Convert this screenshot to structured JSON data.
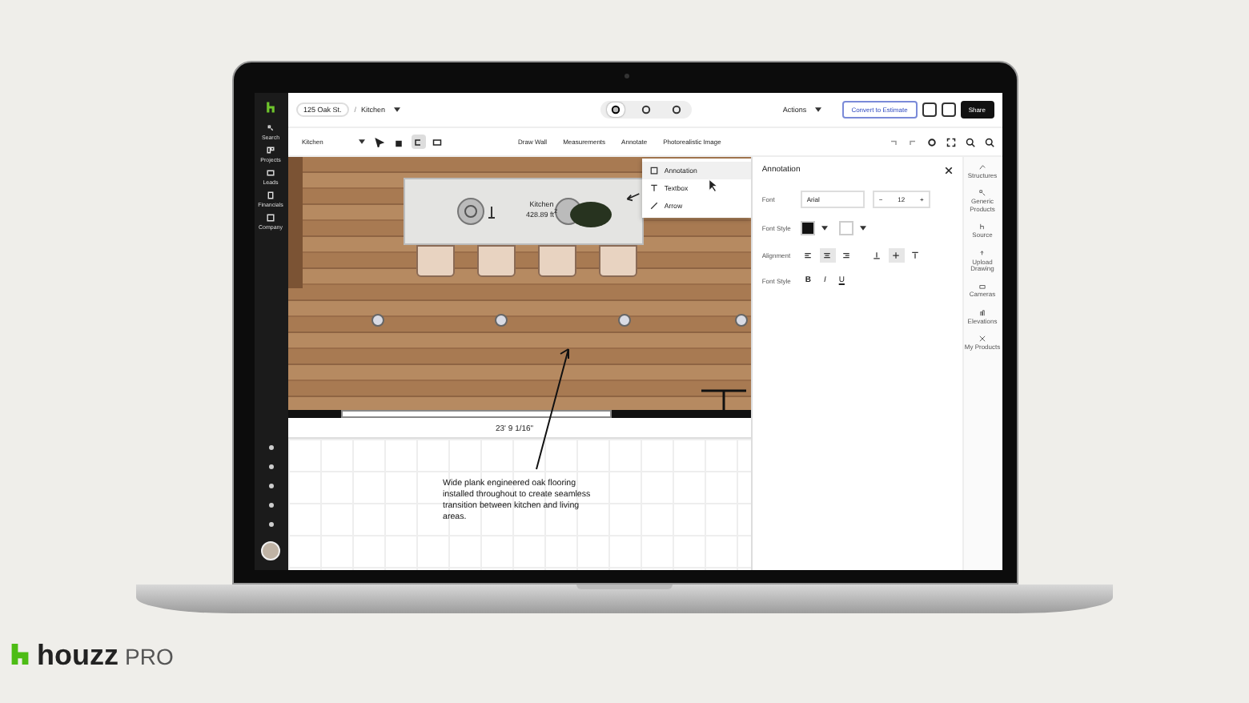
{
  "app_bar": {
    "breadcrumb": [
      {
        "label": "125 Oak St."
      },
      {
        "label": "Kitchen"
      }
    ],
    "separator": "/",
    "view_modes": [
      {
        "selected": true
      },
      {
        "selected": false
      },
      {
        "selected": false
      }
    ],
    "actions_menu": "Actions",
    "convert_button": "Convert to Estimate",
    "share_button": "Share"
  },
  "sidebar": {
    "items": [
      {
        "label": "Search"
      },
      {
        "label": "Projects"
      },
      {
        "label": "Leads"
      },
      {
        "label": "Financials"
      },
      {
        "label": "Company"
      }
    ]
  },
  "toolbar": {
    "level": "Kitchen",
    "tools": [
      {
        "selected": false
      },
      {
        "selected": false
      },
      {
        "selected": true
      },
      {
        "selected": false
      }
    ],
    "menus": [
      {
        "label": "Draw Wall"
      },
      {
        "label": "Measurements"
      },
      {
        "label": "Annotate"
      },
      {
        "label": "Photorealistic Image"
      }
    ]
  },
  "annotate_menu": {
    "items": [
      {
        "label": "Annotation",
        "selected": true
      },
      {
        "label": "Textbox",
        "selected": false
      },
      {
        "label": "Arrow",
        "selected": false
      }
    ]
  },
  "canvas": {
    "room_name": "Kitchen",
    "room_area": "428.89 ft$^{2}$",
    "dimension": "23' 9 1/16\"",
    "note": "Wide plank engineered oak flooring installed throughout to create seamless transition between kitchen and living areas."
  },
  "panel": {
    "title": "Annotation",
    "font_label": "Font",
    "font": "Arial",
    "decrease": "−",
    "font_size": "12",
    "increase": "+",
    "color_label": "Font Style",
    "swatches": [
      {
        "color": "#111111"
      },
      {
        "color": "#ffffff"
      }
    ],
    "alignment_label": "Alignment",
    "h_align": [
      {
        "selected": false
      },
      {
        "selected": true
      },
      {
        "selected": false
      }
    ],
    "v_align": [
      {
        "selected": false
      },
      {
        "selected": true
      },
      {
        "selected": false
      }
    ],
    "style_label": "Font Style",
    "styles": [
      {
        "kind": "bold",
        "label": "B"
      },
      {
        "kind": "italic",
        "label": "I"
      },
      {
        "kind": "underline",
        "label": "U"
      }
    ]
  },
  "right_rail": {
    "items": [
      {
        "label": "Structures"
      },
      {
        "label": "Generic Products"
      },
      {
        "label": "Source"
      },
      {
        "label": "Upload Drawing"
      },
      {
        "label": "Cameras"
      },
      {
        "label": "Elevations"
      },
      {
        "label": "My Products"
      }
    ]
  },
  "brand": {
    "name": "houzz",
    "suffix": "PRO"
  }
}
